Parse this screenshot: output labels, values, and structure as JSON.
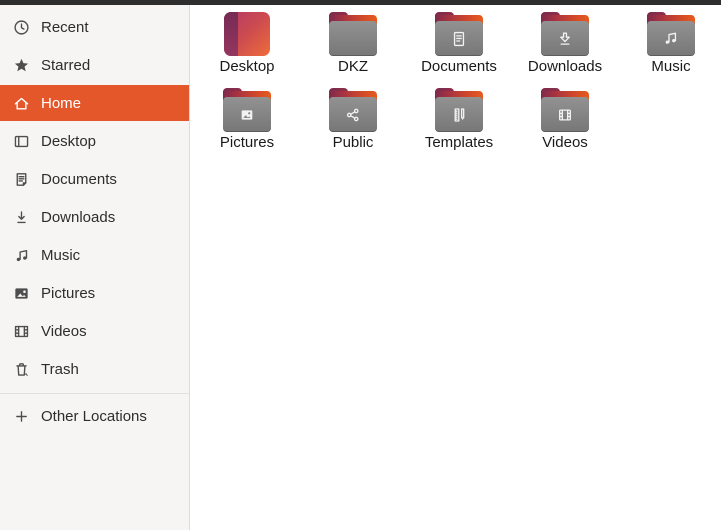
{
  "sidebar": {
    "items": [
      {
        "id": "recent",
        "label": "Recent",
        "icon": "clock-icon",
        "selected": false
      },
      {
        "id": "starred",
        "label": "Starred",
        "icon": "star-icon",
        "selected": false
      },
      {
        "id": "home",
        "label": "Home",
        "icon": "home-icon",
        "selected": true
      },
      {
        "id": "desktop",
        "label": "Desktop",
        "icon": "desktop-panel-icon",
        "selected": false
      },
      {
        "id": "documents",
        "label": "Documents",
        "icon": "document-icon",
        "selected": false
      },
      {
        "id": "downloads",
        "label": "Downloads",
        "icon": "download-icon",
        "selected": false
      },
      {
        "id": "music",
        "label": "Music",
        "icon": "music-note-icon",
        "selected": false
      },
      {
        "id": "pictures",
        "label": "Pictures",
        "icon": "picture-icon",
        "selected": false
      },
      {
        "id": "videos",
        "label": "Videos",
        "icon": "film-icon",
        "selected": false
      },
      {
        "id": "trash",
        "label": "Trash",
        "icon": "trash-icon",
        "selected": false
      }
    ],
    "other_locations": {
      "id": "other-locations",
      "label": "Other Locations",
      "icon": "plus-icon"
    }
  },
  "files": {
    "items": [
      {
        "name": "Desktop",
        "type": "desktop"
      },
      {
        "name": "DKZ",
        "type": "plain"
      },
      {
        "name": "Documents",
        "type": "documents"
      },
      {
        "name": "Downloads",
        "type": "downloads"
      },
      {
        "name": "Music",
        "type": "music"
      },
      {
        "name": "Pictures",
        "type": "pictures"
      },
      {
        "name": "Public",
        "type": "public"
      },
      {
        "name": "Templates",
        "type": "templates"
      },
      {
        "name": "Videos",
        "type": "videos"
      }
    ]
  },
  "colors": {
    "accent": "#e4572b",
    "sidebar_bg": "#f6f5f4",
    "main_bg": "#ffffff",
    "top_bar": "#2e2e2e",
    "folder_gray": "#8a8a8a",
    "folder_flap_maroon": "#7d2a4c",
    "folder_flap_orange": "#e65c1e"
  }
}
